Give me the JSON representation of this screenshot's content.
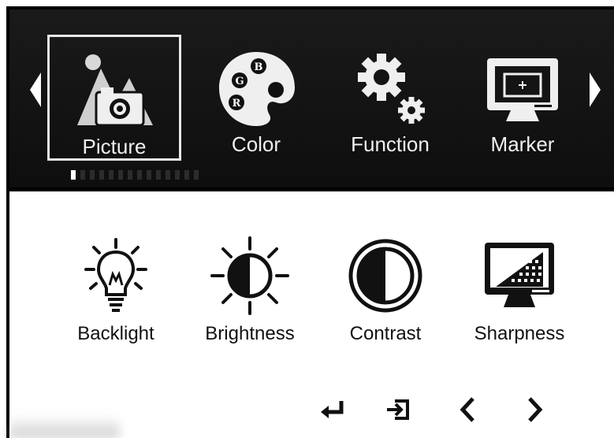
{
  "top_tabs": [
    {
      "label": "Picture",
      "icon": "picture-icon",
      "selected": true
    },
    {
      "label": "Color",
      "icon": "palette-icon",
      "selected": false
    },
    {
      "label": "Function",
      "icon": "gears-icon",
      "selected": false
    },
    {
      "label": "Marker",
      "icon": "monitor-marker-icon",
      "selected": false
    }
  ],
  "pager": {
    "total": 14,
    "active_index": 0
  },
  "picture_items": [
    {
      "label": "Backlight",
      "icon": "bulb-icon"
    },
    {
      "label": "Brightness",
      "icon": "sun-icon"
    },
    {
      "label": "Contrast",
      "icon": "contrast-icon"
    },
    {
      "label": "Sharpness",
      "icon": "sharpness-monitor-icon"
    }
  ],
  "palette_letters": [
    "B",
    "G",
    "R"
  ],
  "nav_buttons": [
    {
      "icon": "enter-icon"
    },
    {
      "icon": "exit-icon"
    },
    {
      "icon": "left-icon"
    },
    {
      "icon": "right-icon"
    }
  ],
  "colors": {
    "panel_bg": "#141414",
    "panel_text": "#f0f0f0",
    "body_text": "#111111",
    "selection_border": "#e8e8e8"
  }
}
